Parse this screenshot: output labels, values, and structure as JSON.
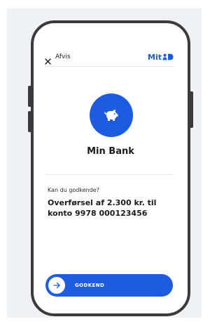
{
  "header": {
    "close_label": "Afvis",
    "logo_text": "Mit"
  },
  "bank": {
    "name": "Min Bank",
    "icon": "piggy-bank-icon"
  },
  "request": {
    "question": "Kan du godkende?",
    "transfer_text": "Overførsel af 2.300 kr. til konto 9978 000123456"
  },
  "approve": {
    "label": "GODKEND",
    "icon": "arrow-right-icon"
  },
  "colors": {
    "brand": "#1d5be0",
    "frame": "#3b3b3d",
    "stage": "#eef2f7"
  }
}
